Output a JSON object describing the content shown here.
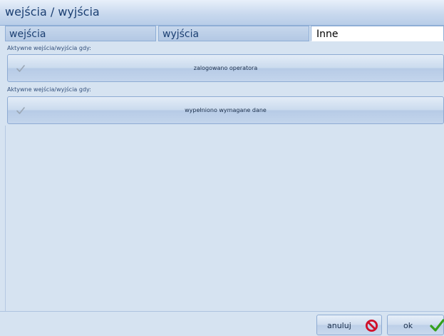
{
  "window": {
    "title": "wejścia / wyjścia"
  },
  "tabs": [
    {
      "label": "wejścia"
    },
    {
      "label": "wyjścia"
    },
    {
      "label": "Inne"
    }
  ],
  "sections": [
    {
      "label": "Aktywne wejścia/wyjścia gdy:",
      "option": {
        "label": "zalogowano operatora",
        "checked": true,
        "icon": "checkmark-icon"
      }
    },
    {
      "label": "Aktywne wejścia/wyjścia gdy:",
      "option": {
        "label": "wypełniono wymagane dane",
        "checked": true,
        "icon": "checkmark-icon"
      }
    }
  ],
  "footer": {
    "cancel_label": "anuluj",
    "cancel_icon": "no-entry-icon",
    "ok_label": "ok",
    "ok_icon": "checkmark-icon"
  },
  "colors": {
    "background": "#d6e3f1",
    "title_text": "#1b3f72",
    "cancel_icon": "#d0102a",
    "ok_icon": "#34a01c",
    "check_muted": "#9aa6b4"
  }
}
